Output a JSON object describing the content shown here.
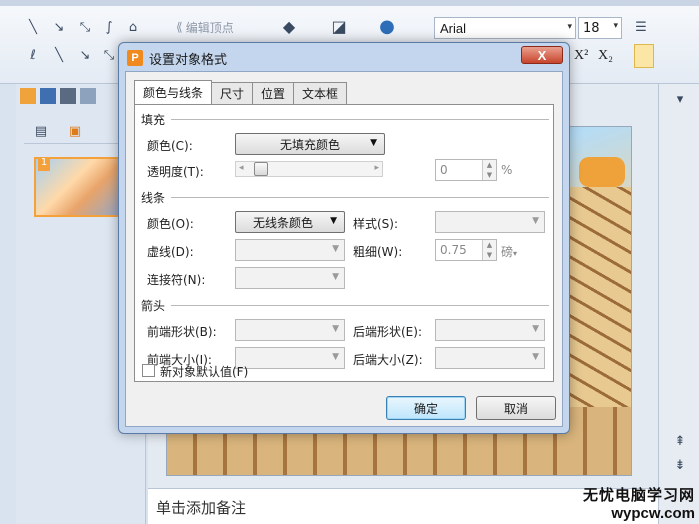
{
  "toolbar": {
    "edit_vertex_label": "编辑顶点",
    "font_name": "Arial",
    "font_size": "18",
    "superscript_label": "X²",
    "subscript_label": "X₂"
  },
  "notes": {
    "placeholder": "单击添加备注"
  },
  "thumbnail": {
    "number": "1"
  },
  "watermark": {
    "line1": "无忧电脑学习网",
    "line2": "wypcw.com"
  },
  "dialog": {
    "icon_letter": "P",
    "title": "设置对象格式",
    "close_label": "X",
    "tabs": [
      "颜色与线条",
      "尺寸",
      "位置",
      "文本框"
    ],
    "fill": {
      "section": "填充",
      "color_label": "颜色(C):",
      "color_value": "无填充颜色",
      "transparency_label": "透明度(T):",
      "transparency_value": "0",
      "transparency_unit": "%"
    },
    "line": {
      "section": "线条",
      "color_label": "颜色(O):",
      "color_value": "无线条颜色",
      "style_label": "样式(S):",
      "dash_label": "虚线(D):",
      "weight_label": "粗细(W):",
      "weight_value": "0.75",
      "weight_unit": "磅",
      "connector_label": "连接符(N):"
    },
    "arrows": {
      "section": "箭头",
      "begin_style_label": "前端形状(B):",
      "end_style_label": "后端形状(E):",
      "begin_size_label": "前端大小(I):",
      "end_size_label": "后端大小(Z):"
    },
    "default_checkbox_label": "新对象默认值(F)",
    "ok_label": "确定",
    "cancel_label": "取消"
  }
}
